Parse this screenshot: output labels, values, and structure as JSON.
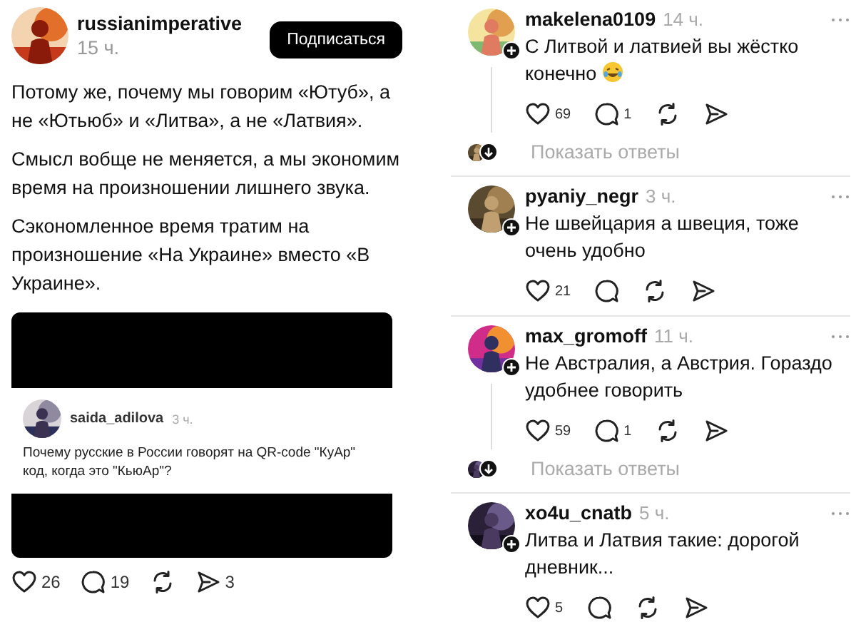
{
  "post": {
    "author": "russianimperative",
    "time": "15 ч.",
    "follow_button": "Подписаться",
    "paragraphs": [
      "Потому же, почему мы говорим «Ютуб», а не «Ютьюб» и «Литва», а не «Латвия».",
      "Смысл вобще не меняется, а мы экономим время на произношении лишнего звука.",
      "Сэкономленное время тратим на произношение «На Украине» вместо «В Украине»."
    ],
    "embed": {
      "author": "saida_adilova",
      "time": "3 ч.",
      "text": "Почему русские в России говорят на QR-code \"КуАр\" код, когда это \"КьюАр\"?"
    },
    "actions": {
      "likes": "26",
      "comments": "19",
      "shares": "3"
    }
  },
  "comments": [
    {
      "author": "makelena0109",
      "time": "14 ч.",
      "text": "С Литвой и латвией вы жёстко конечно",
      "emoji": true,
      "likes": "69",
      "replies": "1",
      "show_replies": "Показать ответы"
    },
    {
      "author": "pyaniy_negr",
      "time": "3 ч.",
      "text": "Не швейцария а швеция, тоже очень удобно",
      "emoji": false,
      "likes": "21"
    },
    {
      "author": "max_gromoff",
      "time": "11 ч.",
      "text": "Не Австралия, а Австрия. Гораздо удобнее говорить",
      "emoji": false,
      "likes": "59",
      "replies": "1",
      "show_replies": "Показать ответы"
    },
    {
      "author": "xo4u_cnatb",
      "time": "5 ч.",
      "text": "Литва и Латвия такие: дорогой дневник...",
      "emoji": false,
      "likes": "5"
    }
  ]
}
